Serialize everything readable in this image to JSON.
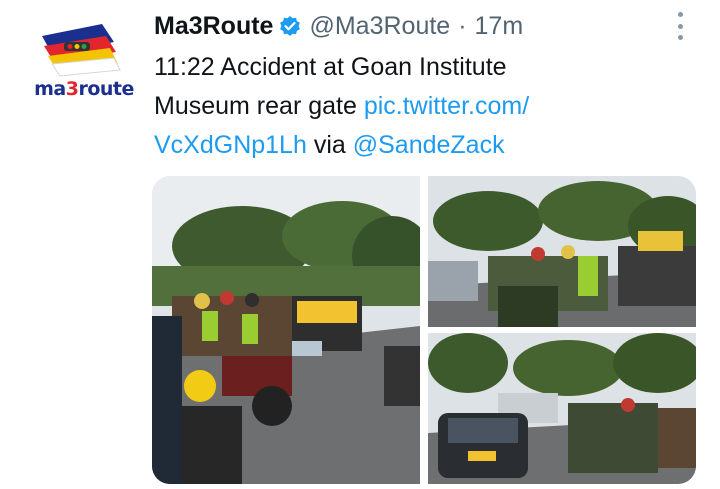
{
  "tweet": {
    "avatar_label_a": "ma",
    "avatar_label_b": "3",
    "avatar_label_c": "route",
    "display_name": "Ma3Route",
    "handle": "@Ma3Route",
    "separator": "·",
    "time": "17m",
    "text_line1": "11:22 Accident at Goan Institute",
    "text_line2": "Museum rear gate ",
    "link_1": "pic.twitter.com/",
    "link_2": "VcXdGNp1Lh",
    "via": " via ",
    "mention": "@SandeZack"
  },
  "icons": {
    "verified": "verified-badge-icon",
    "more": "more-options-icon"
  },
  "colors": {
    "link": "#1d9bf0",
    "secondary": "#536471",
    "text": "#0f1419",
    "brand_blue": "#1b2f8f",
    "brand_red": "#e3262d",
    "brand_yellow": "#f5c400"
  },
  "media": {
    "photos": [
      "accident-photo-1",
      "accident-photo-2",
      "accident-photo-3"
    ]
  }
}
